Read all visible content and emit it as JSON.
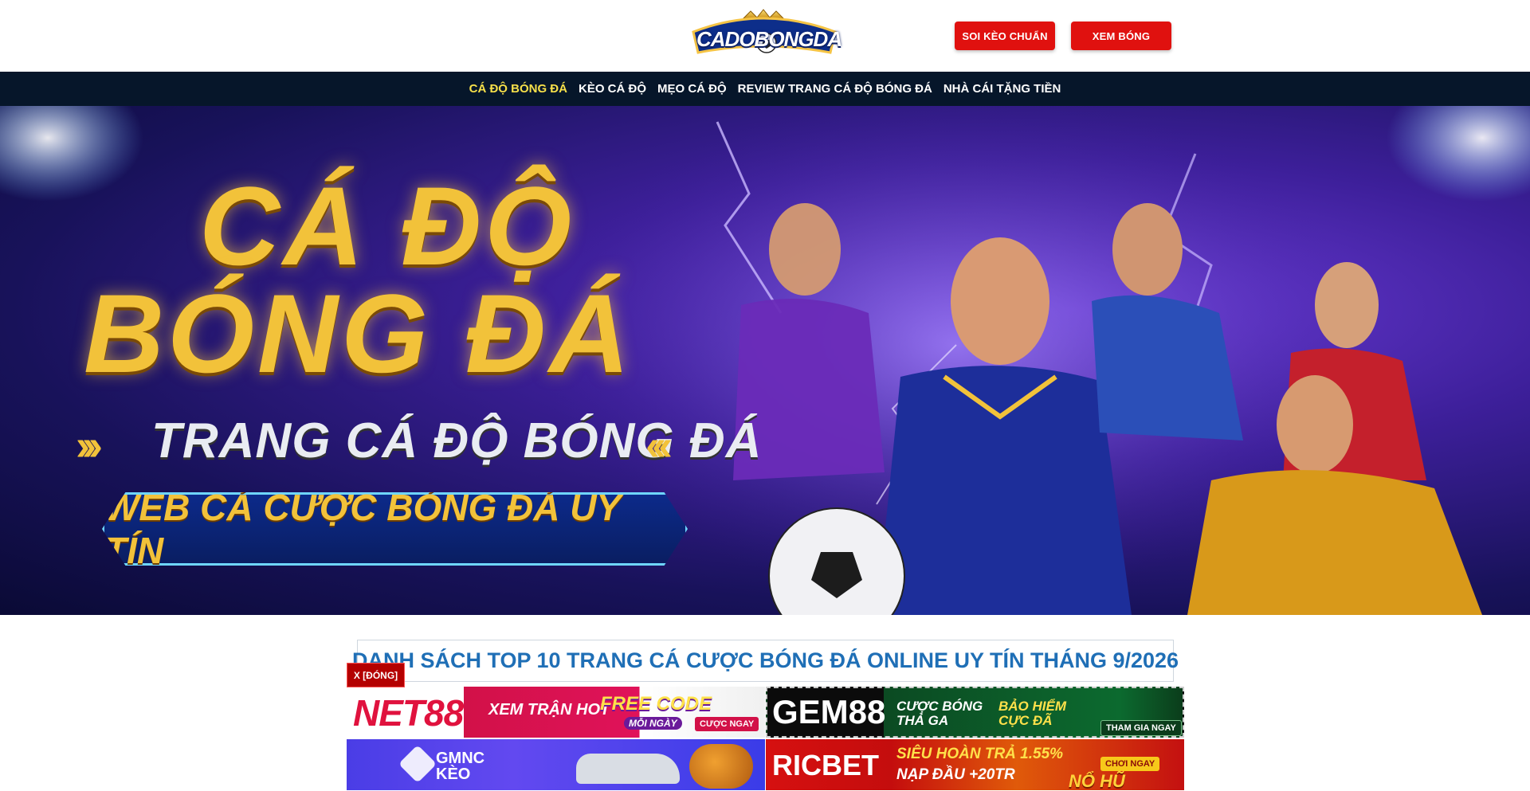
{
  "header": {
    "logo_text": "CADOBONGDA",
    "buttons": [
      {
        "label": "SOI KÈO CHUẨN"
      },
      {
        "label": "XEM BÓNG"
      }
    ]
  },
  "nav": {
    "items": [
      {
        "label": "CÁ ĐỘ BÓNG ĐÁ",
        "active": true
      },
      {
        "label": "KÈO CÁ ĐỘ"
      },
      {
        "label": "MẸO CÁ ĐỘ"
      },
      {
        "label": "REVIEW TRANG CÁ ĐỘ BÓNG ĐÁ"
      },
      {
        "label": "NHÀ CÁI TẶNG TIỀN"
      }
    ]
  },
  "hero": {
    "line1": "CÁ ĐỘ",
    "line2": "BÓNG ĐÁ",
    "subtitle": "TRANG CÁ ĐỘ BÓNG ĐÁ",
    "tagline": "WEB CÁ CƯỢC BÓNG ĐÁ UY TÍN"
  },
  "content": {
    "list_title": "DANH SÁCH TOP 10 TRANG CÁ CƯỢC BÓNG ĐÁ ONLINE UY TÍN THÁNG 9/2026",
    "close_label": "X [ĐÓNG]"
  },
  "banners": [
    {
      "brand": "NET88",
      "promo1": "XEM TRẬN HOT",
      "promo2": "FREE CODE",
      "promo3": "MỖI NGÀY",
      "cta": "CƯỢC NGAY"
    },
    {
      "brand": "GEM88",
      "promo1": "CƯỢC BÓNG THẢ GA",
      "promo2": "BẢO HIỂM CỰC ĐÃ",
      "cta": "THAM GIA NGAY"
    },
    {
      "brand": "GMNC KÈO"
    },
    {
      "brand": "RICBET",
      "promo1": "SIÊU HOÀN TRẢ 1.55%",
      "promo2": "NẠP ĐẦU +20TR",
      "cta": "CHƠI NGAY",
      "promo3": "NỔ HŨ"
    }
  ],
  "colors": {
    "nav_bg": "#06162a",
    "nav_active": "#f7e04a",
    "button_red": "#e0110f",
    "title_blue": "#1f6fb6",
    "hero_gold": "#f2c23a"
  }
}
